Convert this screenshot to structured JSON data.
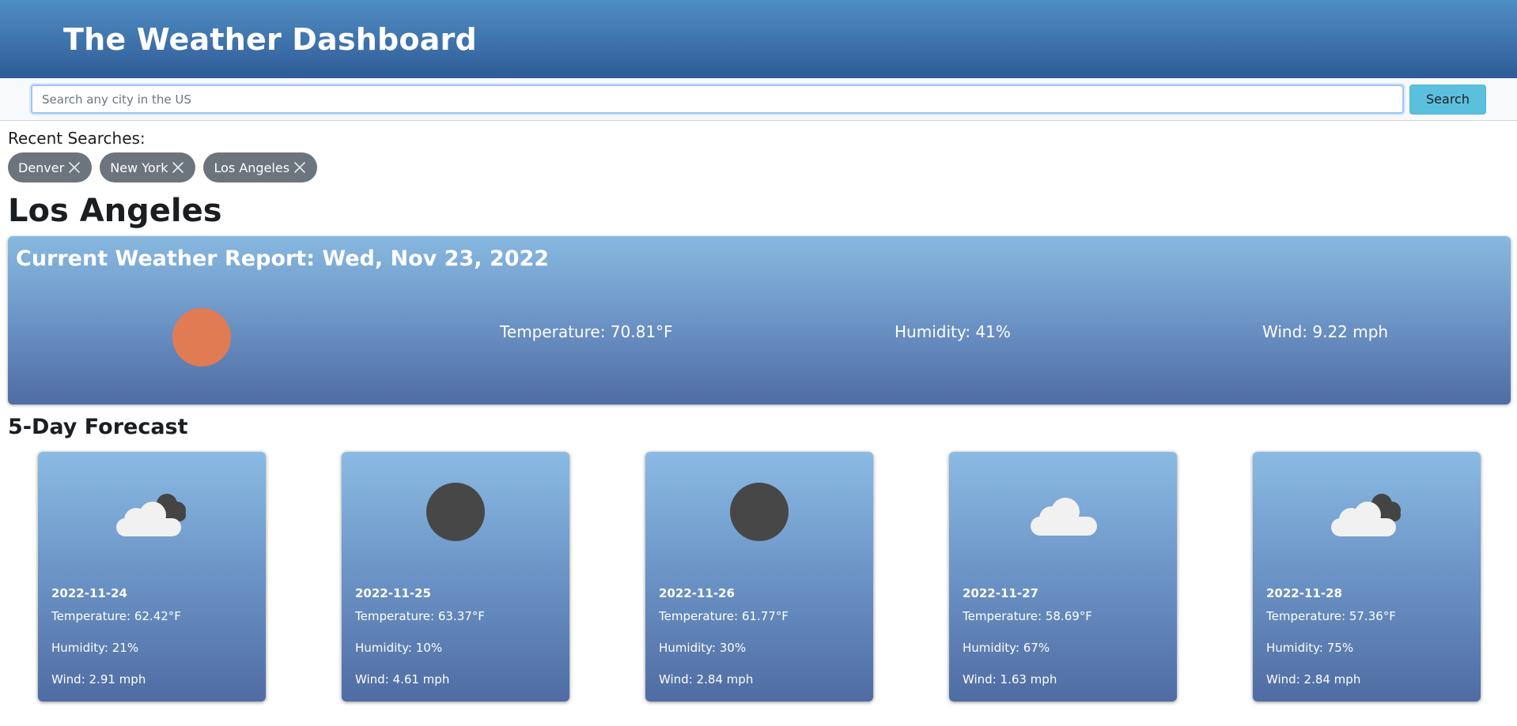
{
  "header": {
    "title": "The Weather Dashboard"
  },
  "search": {
    "placeholder": "Search any city in the US",
    "value": "",
    "button_label": "Search"
  },
  "recent": {
    "title": "Recent Searches:",
    "items": [
      {
        "label": "Denver"
      },
      {
        "label": "New York"
      },
      {
        "label": "Los Angeles"
      }
    ]
  },
  "city": "Los Angeles",
  "current": {
    "title": "Current Weather Report: Wed, Nov 23, 2022",
    "icon": "sun-icon",
    "temperature": "Temperature: 70.81°F",
    "humidity": "Humidity: 41%",
    "wind": "Wind: 9.22 mph"
  },
  "forecast": {
    "title": "5-Day Forecast",
    "days": [
      {
        "date": "2022-11-24",
        "icon": "cloudy-icon",
        "temperature": "Temperature: 62.42°F",
        "humidity": "Humidity: 21%",
        "wind": "Wind: 2.91 mph"
      },
      {
        "date": "2022-11-25",
        "icon": "clear-night-icon",
        "temperature": "Temperature: 63.37°F",
        "humidity": "Humidity: 10%",
        "wind": "Wind: 4.61 mph"
      },
      {
        "date": "2022-11-26",
        "icon": "clear-night-icon",
        "temperature": "Temperature: 61.77°F",
        "humidity": "Humidity: 30%",
        "wind": "Wind: 2.84 mph"
      },
      {
        "date": "2022-11-27",
        "icon": "cloud-icon",
        "temperature": "Temperature: 58.69°F",
        "humidity": "Humidity: 67%",
        "wind": "Wind: 1.63 mph"
      },
      {
        "date": "2022-11-28",
        "icon": "cloudy-icon",
        "temperature": "Temperature: 57.36°F",
        "humidity": "Humidity: 75%",
        "wind": "Wind: 2.84 mph"
      }
    ]
  },
  "colors": {
    "header": "#3f72ab",
    "search_button": "#5bc0de",
    "chip": "#6c757d",
    "sun": "#e07b54"
  }
}
